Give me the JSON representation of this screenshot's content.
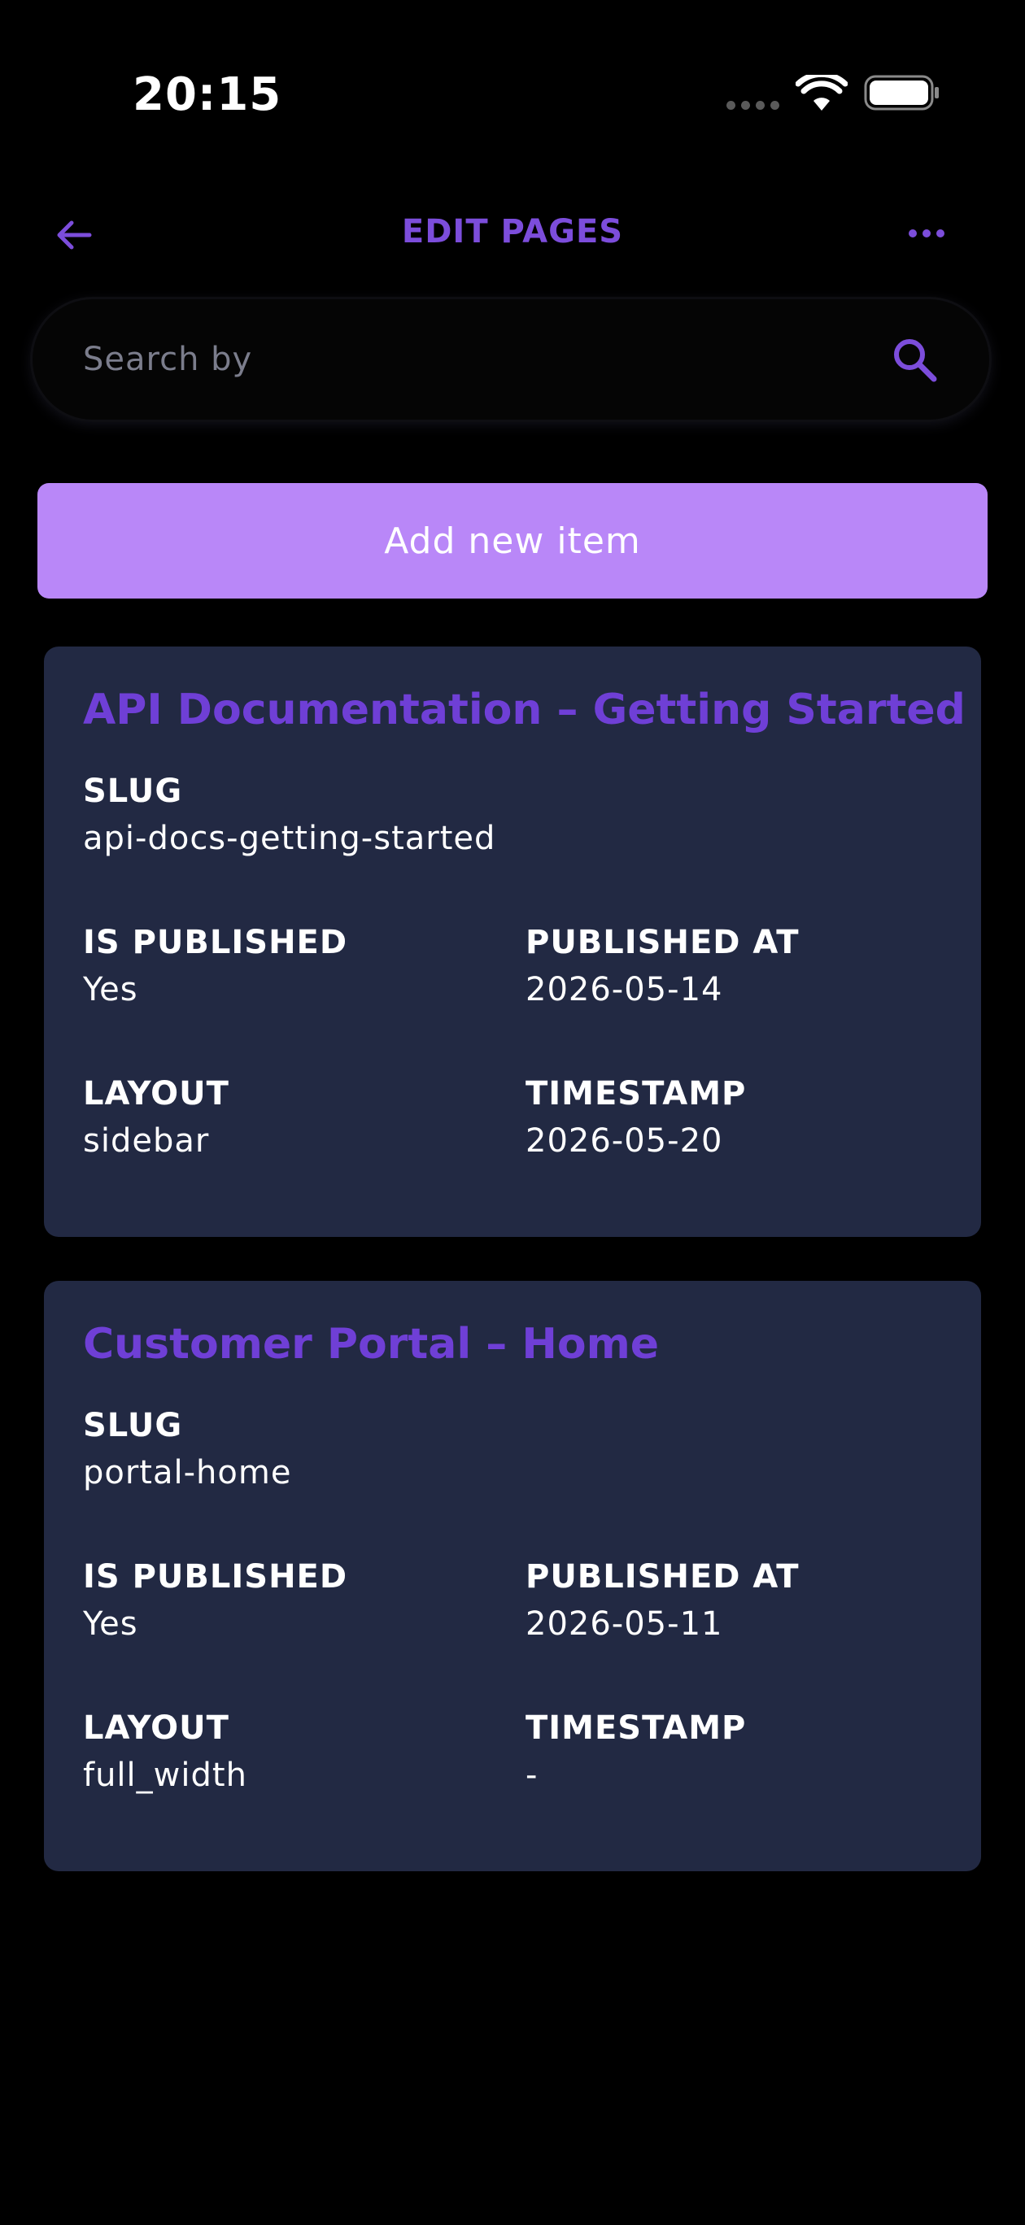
{
  "status_bar": {
    "time": "20:15"
  },
  "nav": {
    "title": "EDIT PAGES",
    "back_icon": "arrow-left-icon",
    "more_icon": "more-horizontal-icon"
  },
  "search": {
    "placeholder": "Search by",
    "value": "",
    "icon": "search-icon"
  },
  "add_button": {
    "label": "Add new item"
  },
  "colors": {
    "accent": "#7c4ddb",
    "title_purple": "#6f3fd6",
    "button_bg": "#b987f8",
    "card_bg": "#222943",
    "background": "#000000"
  },
  "labels": {
    "slug": "SLUG",
    "is_published": "IS PUBLISHED",
    "published_at": "PUBLISHED AT",
    "layout": "LAYOUT",
    "timestamp": "TIMESTAMP"
  },
  "items": [
    {
      "title": "API Documentation – Getting Started",
      "slug": "api-docs-getting-started",
      "is_published": "Yes",
      "published_at": "2026-05-14",
      "layout": "sidebar",
      "timestamp": "2026-05-20"
    },
    {
      "title": "Customer Portal – Home",
      "slug": "portal-home",
      "is_published": "Yes",
      "published_at": "2026-05-11",
      "layout": "full_width",
      "timestamp": "-"
    }
  ]
}
